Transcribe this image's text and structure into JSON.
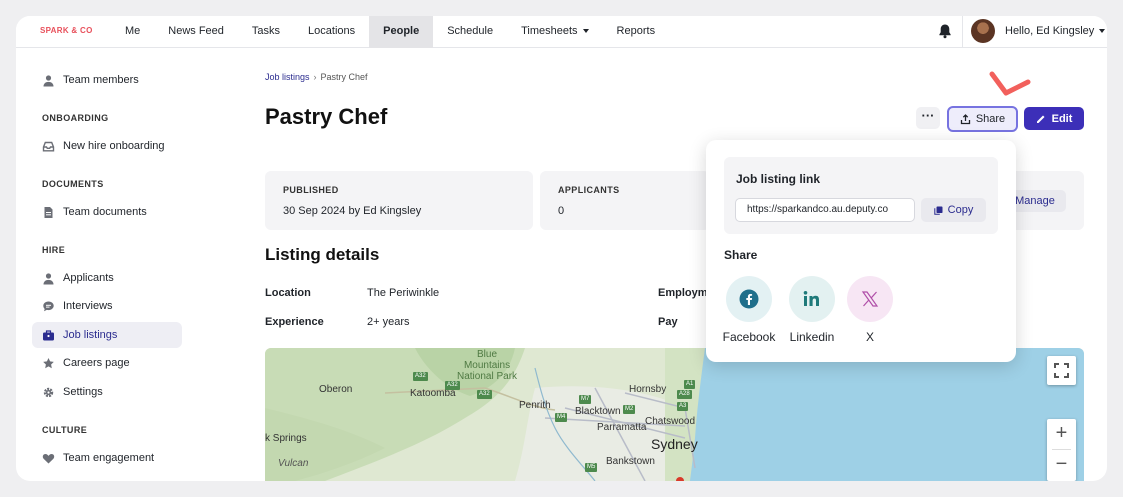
{
  "nav": {
    "brand": "SPARK & CO",
    "links": [
      "Me",
      "News Feed",
      "Tasks",
      "Locations",
      "People",
      "Schedule",
      "Timesheets",
      "Reports"
    ],
    "active": "People",
    "greeting": "Hello, Ed Kingsley"
  },
  "sidebar": {
    "top_item": "Team members",
    "sections": [
      {
        "heading": "ONBOARDING",
        "items": [
          "New hire onboarding"
        ]
      },
      {
        "heading": "DOCUMENTS",
        "items": [
          "Team documents"
        ]
      },
      {
        "heading": "HIRE",
        "items": [
          "Applicants",
          "Interviews",
          "Job listings",
          "Careers page",
          "Settings"
        ]
      },
      {
        "heading": "CULTURE",
        "items": [
          "Team engagement"
        ]
      }
    ],
    "active": "Job listings"
  },
  "breadcrumb": {
    "parent": "Job listings",
    "current": "Pastry Chef"
  },
  "page": {
    "title": "Pastry Chef",
    "more_label": "···",
    "share_label": "Share",
    "edit_label": "Edit"
  },
  "cards": {
    "published_label": "PUBLISHED",
    "published_value": "30 Sep 2024 by Ed Kingsley",
    "applicants_label": "APPLICANTS",
    "applicants_value": "0",
    "manage_label": "Manage"
  },
  "details": {
    "heading": "Listing details",
    "location_label": "Location",
    "location_value": "The Periwinkle",
    "experience_label": "Experience",
    "experience_value": "2+ years",
    "employment_label": "Employm",
    "pay_label": "Pay"
  },
  "map": {
    "labels": {
      "blue_mountains": "Blue\nMountains\nNational Park",
      "oberon": "Oberon",
      "katoomba": "Katoomba",
      "penrith": "Penrith",
      "blacktown": "Blacktown",
      "hornsby": "Hornsby",
      "parramatta": "Parramatta",
      "chatswood": "Chatswood",
      "sydney": "Sydney",
      "bankstown": "Bankstown",
      "ksprings": "k Springs",
      "vulcan": "Vulcan"
    },
    "shields": [
      "A32",
      "A32",
      "A32",
      "M7",
      "M4",
      "M2",
      "A3",
      "A28",
      "M5",
      "A1"
    ],
    "zoom_in": "+",
    "zoom_out": "−"
  },
  "share_popover": {
    "link_title": "Job listing link",
    "link_value": "https://sparkandco.au.deputy.co",
    "copy_label": "Copy",
    "share_heading": "Share",
    "networks": [
      "Facebook",
      "Linkedin",
      "X"
    ]
  },
  "colors": {
    "accent": "#3c2fb8",
    "brand": "#e8505b",
    "annotation_check": "#f2605c",
    "facebook": "#1f6f8b",
    "linkedin": "#1f7a7a",
    "x": "#b04fa8"
  }
}
